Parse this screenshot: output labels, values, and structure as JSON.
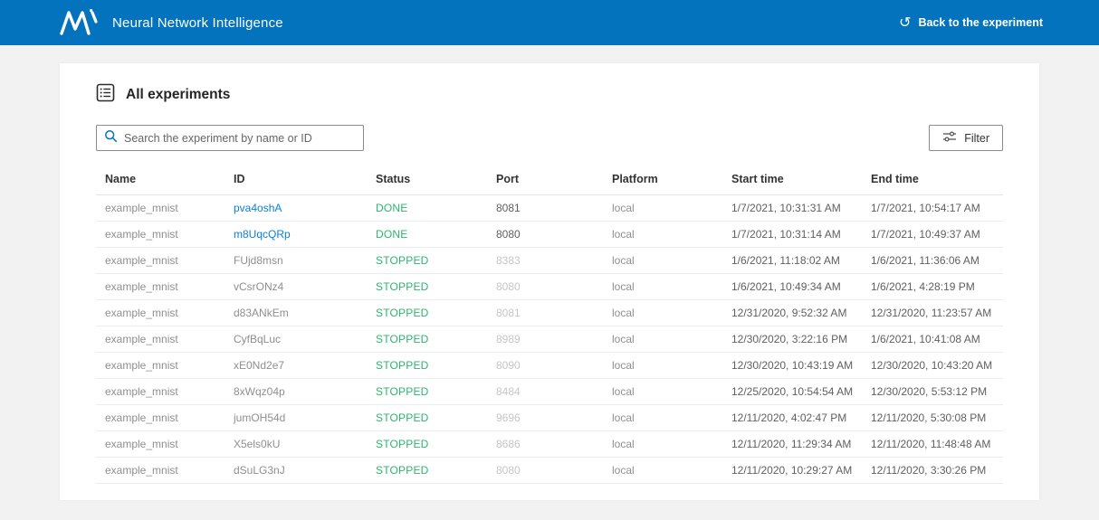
{
  "header": {
    "brand": "Neural Network Intelligence",
    "back_label": "Back to the experiment",
    "back_icon_char": "↺"
  },
  "page": {
    "title": "All experiments",
    "search_placeholder": "Search the experiment by name or ID",
    "search_value": "",
    "filter_label": "Filter"
  },
  "colors": {
    "header_bg": "#0473bd",
    "link_blue": "#0b80d4",
    "status_green": "#2db56e"
  },
  "table": {
    "columns": [
      "Name",
      "ID",
      "Status",
      "Port",
      "Platform",
      "Start time",
      "End time"
    ],
    "rows": [
      {
        "name": "example_mnist",
        "id": "pva4oshA",
        "id_is_link": true,
        "status": "DONE",
        "port": "8081",
        "port_active": true,
        "platform": "local",
        "start": "1/7/2021, 10:31:31 AM",
        "end": "1/7/2021, 10:54:17 AM"
      },
      {
        "name": "example_mnist",
        "id": "m8UqcQRp",
        "id_is_link": true,
        "status": "DONE",
        "port": "8080",
        "port_active": true,
        "platform": "local",
        "start": "1/7/2021, 10:31:14 AM",
        "end": "1/7/2021, 10:49:37 AM"
      },
      {
        "name": "example_mnist",
        "id": "FUjd8msn",
        "id_is_link": false,
        "status": "STOPPED",
        "port": "8383",
        "port_active": false,
        "platform": "local",
        "start": "1/6/2021, 11:18:02 AM",
        "end": "1/6/2021, 11:36:06 AM"
      },
      {
        "name": "example_mnist",
        "id": "vCsrONz4",
        "id_is_link": false,
        "status": "STOPPED",
        "port": "8080",
        "port_active": false,
        "platform": "local",
        "start": "1/6/2021, 10:49:34 AM",
        "end": "1/6/2021, 4:28:19 PM"
      },
      {
        "name": "example_mnist",
        "id": "d83ANkEm",
        "id_is_link": false,
        "status": "STOPPED",
        "port": "8081",
        "port_active": false,
        "platform": "local",
        "start": "12/31/2020, 9:52:32 AM",
        "end": "12/31/2020, 11:23:57 AM"
      },
      {
        "name": "example_mnist",
        "id": "CyfBqLuc",
        "id_is_link": false,
        "status": "STOPPED",
        "port": "8989",
        "port_active": false,
        "platform": "local",
        "start": "12/30/2020, 3:22:16 PM",
        "end": "1/6/2021, 10:41:08 AM"
      },
      {
        "name": "example_mnist",
        "id": "xE0Nd2e7",
        "id_is_link": false,
        "status": "STOPPED",
        "port": "8090",
        "port_active": false,
        "platform": "local",
        "start": "12/30/2020, 10:43:19 AM",
        "end": "12/30/2020, 10:43:20 AM"
      },
      {
        "name": "example_mnist",
        "id": "8xWqz04p",
        "id_is_link": false,
        "status": "STOPPED",
        "port": "8484",
        "port_active": false,
        "platform": "local",
        "start": "12/25/2020, 10:54:54 AM",
        "end": "12/30/2020, 5:53:12 PM"
      },
      {
        "name": "example_mnist",
        "id": "jumOH54d",
        "id_is_link": false,
        "status": "STOPPED",
        "port": "9696",
        "port_active": false,
        "platform": "local",
        "start": "12/11/2020, 4:02:47 PM",
        "end": "12/11/2020, 5:30:08 PM"
      },
      {
        "name": "example_mnist",
        "id": "X5els0kU",
        "id_is_link": false,
        "status": "STOPPED",
        "port": "8686",
        "port_active": false,
        "platform": "local",
        "start": "12/11/2020, 11:29:34 AM",
        "end": "12/11/2020, 11:48:48 AM"
      },
      {
        "name": "example_mnist",
        "id": "dSuLG3nJ",
        "id_is_link": false,
        "status": "STOPPED",
        "port": "8080",
        "port_active": false,
        "platform": "local",
        "start": "12/11/2020, 10:29:27 AM",
        "end": "12/11/2020, 3:30:26 PM"
      }
    ]
  }
}
